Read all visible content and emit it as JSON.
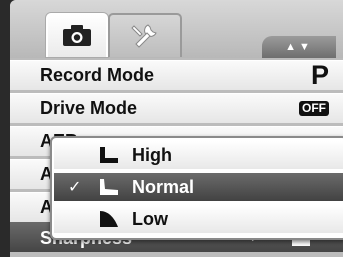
{
  "tabs": [
    {
      "name": "camera-tab",
      "icon": "camera-icon"
    },
    {
      "name": "setup-tab",
      "icon": "wrench-icon"
    }
  ],
  "scroll_indicator": "▲▼",
  "menu": {
    "items": [
      {
        "label": "Record Mode",
        "value": "P"
      },
      {
        "label": "Drive Mode",
        "value": "OFF"
      },
      {
        "label": "AEB",
        "value": ""
      },
      {
        "label": "AF",
        "value": ""
      },
      {
        "label": "AE",
        "value": ""
      }
    ],
    "selected": {
      "label": "Sharpness",
      "arrow": "►"
    }
  },
  "popup": {
    "options": [
      {
        "label": "High",
        "checked": false,
        "icon": "sharpness-high-icon"
      },
      {
        "label": "Normal",
        "checked": true,
        "icon": "sharpness-normal-icon"
      },
      {
        "label": "Low",
        "checked": false,
        "icon": "sharpness-low-icon"
      }
    ],
    "check_mark": "✓"
  }
}
